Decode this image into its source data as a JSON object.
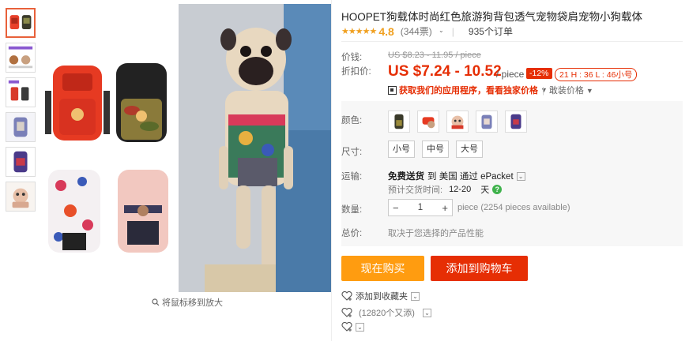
{
  "product": {
    "title": "HOOPET狗载体时尚红色旅游狗背包透气宠物袋肩宠物小狗载体",
    "stars": "★★★★★",
    "rating": "4.8",
    "reviews": "(344票)",
    "orders": "935个订单"
  },
  "price": {
    "label": "价钱:",
    "original": "US $8.23 - 11.95 / piece",
    "discount_label": "折扣价:",
    "current": "US $7.24 - 10.52",
    "unit": "/ piece",
    "discount_badge": "-12%",
    "timer": "21 H : 36 L : 46小号",
    "app_price": "获取我们的应用程序，看看独家价格",
    "coupon_link": "敢装价格"
  },
  "options": {
    "color_label": "颜色:",
    "size_label": "尺寸:",
    "sizes": [
      "小号",
      "中号",
      "大号"
    ],
    "shipping_label": "运输:",
    "shipping_free": "免费送货",
    "shipping_to": "到 美国 通过 ePacket",
    "eta_label": "预计交货时间:",
    "eta_value": "12-20",
    "eta_unit": "天",
    "qty_label": "数量:",
    "qty_minus": "−",
    "qty_value": "1",
    "qty_plus": "+",
    "qty_available": "piece (2254 pieces available)",
    "total_label": "总价:",
    "total_value": "取决于您选择的产品性能"
  },
  "actions": {
    "buy_now": "现在购买",
    "add_to_cart": "添加到购物车",
    "add_to_wishlist": "添加到收藏夹",
    "wish_count": "(12820个又添)"
  },
  "gallery": {
    "zoom_hint": "将鼠标移到放大"
  },
  "colors": {
    "accent": "#e62e04",
    "buy": "#ff9c10",
    "star": "#f0a020"
  }
}
